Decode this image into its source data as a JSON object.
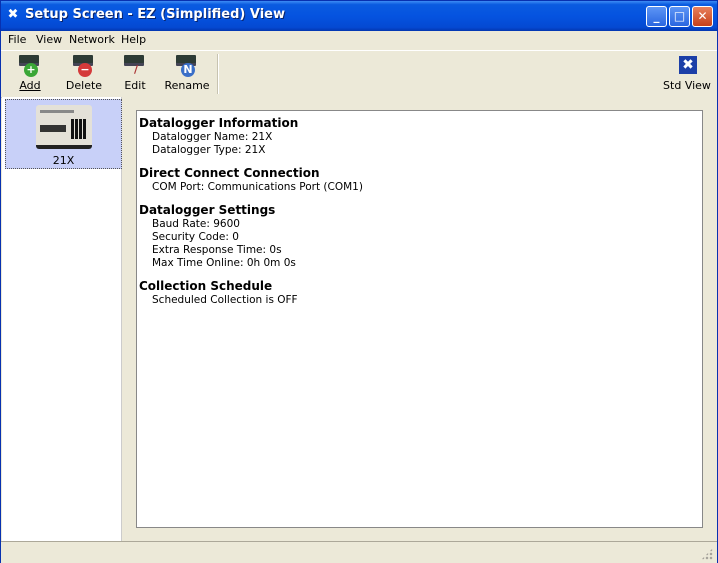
{
  "window": {
    "title": "Setup Screen - EZ (Simplified) View",
    "app_icon": "wrench-icon",
    "controls": {
      "minimize": "_",
      "maximize": "□",
      "close": "✕"
    }
  },
  "menu": [
    "File",
    "View",
    "Network",
    "Help"
  ],
  "toolbar": {
    "add": {
      "label": "Add",
      "mnemonic": "A"
    },
    "delete": {
      "label": "Delete",
      "mnemonic": "D"
    },
    "edit": {
      "label": "Edit",
      "mnemonic": "E"
    },
    "rename": {
      "label": "Rename",
      "mnemonic": "n"
    },
    "std_view": {
      "label": "Std View"
    }
  },
  "stations": [
    {
      "label": "21X",
      "selected": true
    }
  ],
  "details": {
    "sections": [
      {
        "title": "Datalogger Information",
        "lines": [
          "Datalogger Name: 21X",
          "Datalogger Type: 21X"
        ]
      },
      {
        "title": "Direct Connect Connection",
        "lines": [
          "COM Port: Communications Port (COM1)"
        ]
      },
      {
        "title": "Datalogger Settings",
        "lines": [
          "Baud Rate: 9600",
          "Security Code: 0",
          "Extra Response Time: 0s",
          "Max Time Online: 0h 0m 0s"
        ]
      },
      {
        "title": "Collection Schedule",
        "lines": [
          "Scheduled Collection is OFF"
        ]
      }
    ]
  },
  "colors": {
    "titlebar": "#0553e0",
    "selection": "#c8d0f8",
    "chrome": "#ece9d8"
  }
}
